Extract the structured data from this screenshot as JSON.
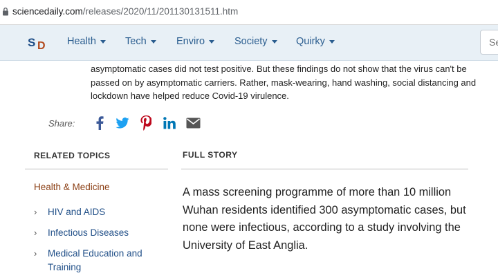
{
  "browser": {
    "url_domain": "sciencedaily.com",
    "url_path": "/releases/2020/11/201130131511.htm"
  },
  "nav": {
    "logo_s": "S",
    "logo_d": "D",
    "items": [
      {
        "label": "Health"
      },
      {
        "label": "Tech"
      },
      {
        "label": "Enviro"
      },
      {
        "label": "Society"
      },
      {
        "label": "Quirky"
      }
    ],
    "search_placeholder": "Se"
  },
  "article": {
    "intro_text": "asymptomatic cases did not test positive. But these findings do not show that the virus can't be passed on by asymptomatic carriers. Rather, mask-wearing, hand washing, social distancing and lockdown have helped reduce Covid-19 virulence.",
    "share_label": "Share:",
    "share_icons": [
      "facebook-icon",
      "twitter-icon",
      "pinterest-icon",
      "linkedin-icon",
      "email-icon"
    ],
    "full_story_title": "FULL STORY",
    "story_text": "A mass screening programme of more than 10 million Wuhan residents identified 300 asymptomatic cases, but none were infectious, according to a study involving the University of East Anglia."
  },
  "related_topics": {
    "title": "RELATED TOPICS",
    "category": "Health & Medicine",
    "items": [
      {
        "label": "HIV and AIDS"
      },
      {
        "label": "Infectious Diseases"
      },
      {
        "label": "Medical Education and Training"
      }
    ]
  },
  "colors": {
    "nav_bg": "#e8f0f6",
    "link": "#1f4e87",
    "category": "#8a3d12",
    "facebook": "#3b5998",
    "twitter": "#1da1f2",
    "pinterest": "#bd081c",
    "linkedin": "#0077b5",
    "email": "#555555"
  }
}
